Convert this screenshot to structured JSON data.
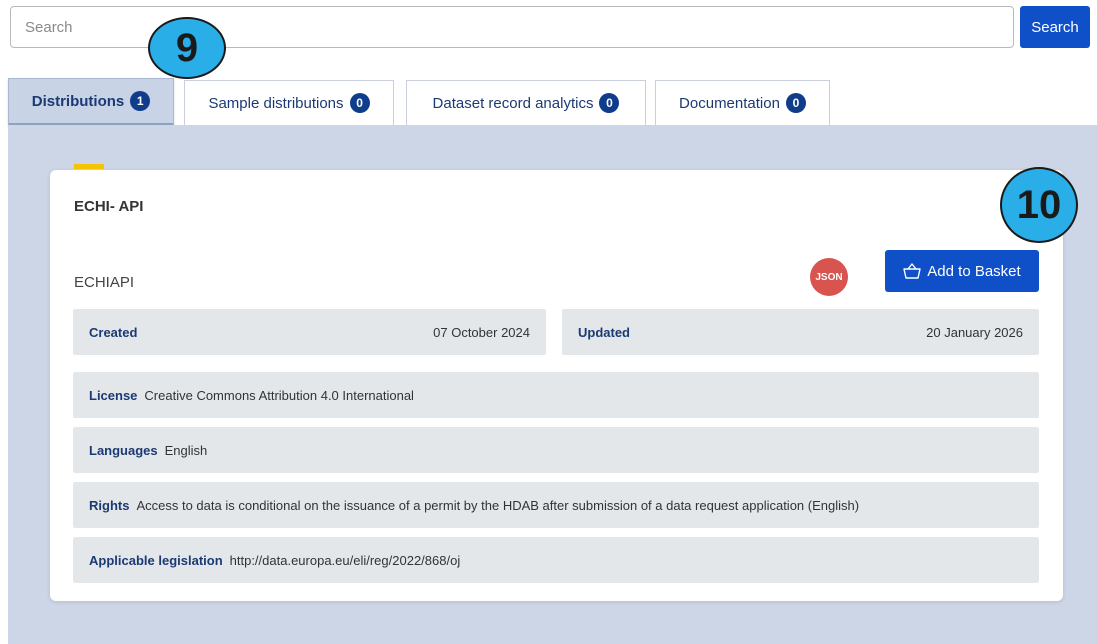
{
  "search": {
    "placeholder": "Search",
    "button_label": "Search"
  },
  "callouts": {
    "first": "9",
    "second": "10"
  },
  "tabs": [
    {
      "label": "Distributions",
      "count": "1",
      "active": true
    },
    {
      "label": "Sample distributions",
      "count": "0",
      "active": false
    },
    {
      "label": "Dataset record analytics",
      "count": "0",
      "active": false
    },
    {
      "label": "Documentation",
      "count": "0",
      "active": false
    }
  ],
  "distribution": {
    "title": "ECHI- API",
    "subtitle": "ECHIAPI",
    "format": "JSON",
    "add_to_basket_label": "Add to Basket",
    "created_label": "Created",
    "created_value": "07 October 2024",
    "updated_label": "Updated",
    "updated_value": "20 January 2026",
    "license_label": "License",
    "license_value": "Creative Commons Attribution 4.0 International",
    "languages_label": "Languages",
    "languages_value": "English",
    "rights_label": "Rights",
    "rights_value": "Access to data is conditional on the issuance of a permit by the HDAB after submission of a data request application (English)",
    "legislation_label": "Applicable legislation",
    "legislation_value": "http://data.europa.eu/eli/reg/2022/868/oj"
  },
  "colors": {
    "primary_button": "#0f4fc8",
    "badge": "#0f3d8c",
    "panel_background": "#cdd6e6",
    "callout": "#29aee8",
    "format_badge": "#d9534f",
    "accent": "#f5c400"
  },
  "icons": {
    "basket": "basket-icon"
  }
}
